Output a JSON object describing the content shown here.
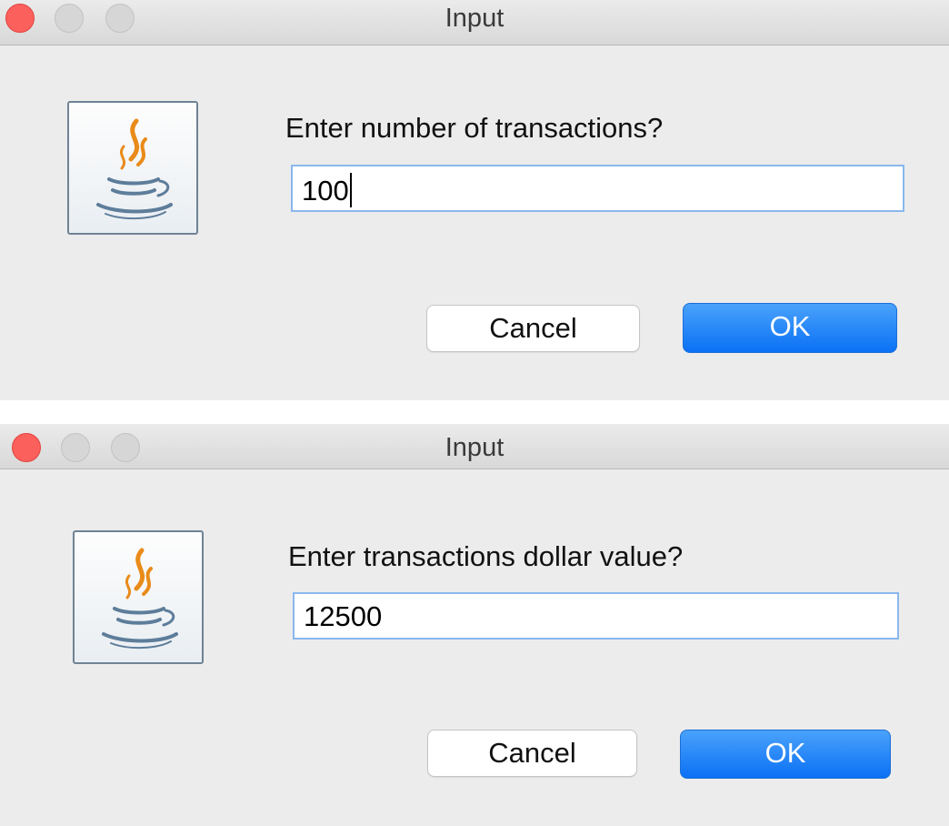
{
  "colors": {
    "dialog_bg": "#ececec",
    "close_button": "#fc605c",
    "ok_button": "#1a7bf5",
    "field_focus_border": "#8ab8ee"
  },
  "dialogs": [
    {
      "title": "Input",
      "icon": "java-logo-icon",
      "prompt": "Enter number of transactions?",
      "input_value": "100",
      "cancel_label": "Cancel",
      "ok_label": "OK",
      "focused": true
    },
    {
      "title": "Input",
      "icon": "java-logo-icon",
      "prompt": "Enter transactions dollar value?",
      "input_value": "12500",
      "cancel_label": "Cancel",
      "ok_label": "OK",
      "focused": false
    }
  ]
}
